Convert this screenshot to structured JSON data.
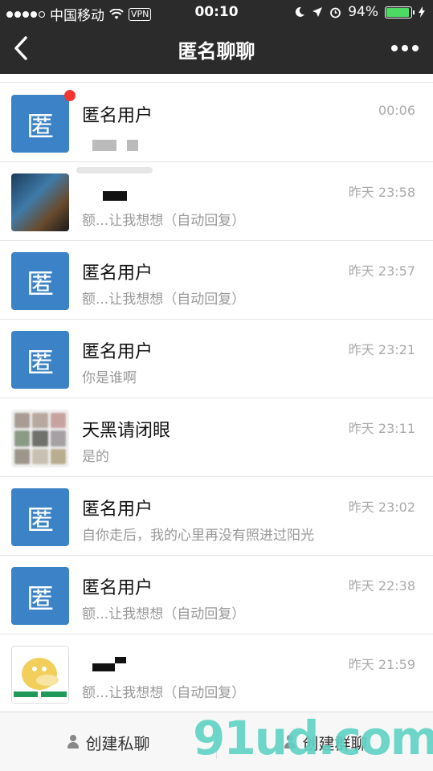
{
  "status_bar": {
    "carrier": "中国移动",
    "vpn": "VPN",
    "time": "00:10",
    "battery": "94%",
    "battery_level": 0.94,
    "battery_color": "#4cd964"
  },
  "navbar": {
    "back_icon": "chevron-left-icon",
    "title": "匿名聊聊",
    "more_icon": "more-icon"
  },
  "conversations": [
    {
      "avatar": "匿",
      "name": "匿名用户",
      "message": "",
      "time": "00:06",
      "unread_badge": true
    },
    {
      "avatar": "",
      "name": "",
      "message": "额...让我想想（自动回复）",
      "time": "昨天 23:58"
    },
    {
      "avatar": "匿",
      "name": "匿名用户",
      "message": "额...让我想想（自动回复）",
      "time": "昨天 23:57"
    },
    {
      "avatar": "匿",
      "name": "匿名用户",
      "message": "你是谁啊",
      "time": "昨天 23:21"
    },
    {
      "avatar": "",
      "name": "天黑请闭眼",
      "message": "是的",
      "time": "昨天 23:11"
    },
    {
      "avatar": "匿",
      "name": "匿名用户",
      "message": "自你走后，我的心里再没有照进过阳光",
      "time": "昨天 23:02"
    },
    {
      "avatar": "匿",
      "name": "匿名用户",
      "message": "额...让我想想（自动回复）",
      "time": "昨天 22:38"
    },
    {
      "avatar": "",
      "name": "",
      "message": "额...让我想想（自动回复）",
      "time": "昨天 21:59"
    }
  ],
  "bottom_bar": {
    "private_chat": "创建私聊",
    "group_chat": "创建群聊"
  },
  "watermark": "91ud.com",
  "colors": {
    "header_bg": "#2b2b2b",
    "anon_avatar": "#3b83c6",
    "badge": "#f43530"
  }
}
